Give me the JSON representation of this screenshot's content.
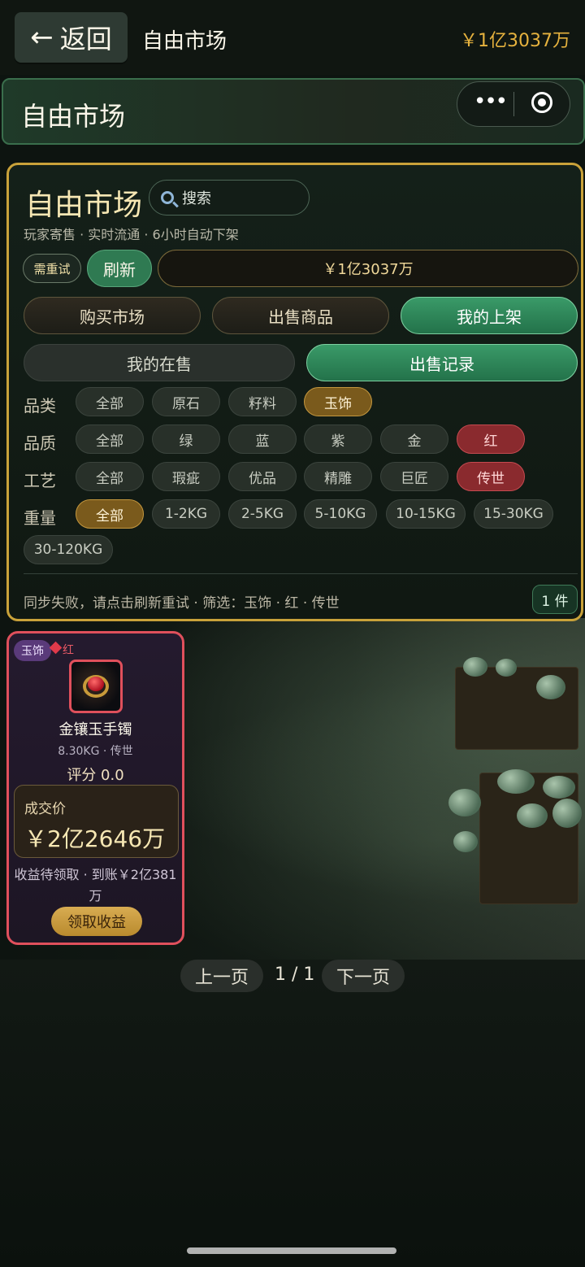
{
  "topbar": {
    "back_label": "返回",
    "title": "自由市场",
    "balance": "￥1亿3037万"
  },
  "navbar": {
    "title": "自由市场",
    "more_icon": "more-dots-icon",
    "close_icon": "target-icon"
  },
  "panel": {
    "title": "自由市场",
    "search_placeholder": "搜索",
    "subtitle": "玩家寄售 · 实时流通 · 6小时自动下架",
    "retry_badge": "需重试",
    "refresh_label": "刷新",
    "balance": "￥1亿3037万",
    "tabs_row1": [
      {
        "label": "购买市场",
        "active": false
      },
      {
        "label": "出售商品",
        "active": false
      },
      {
        "label": "我的上架",
        "active": true
      }
    ],
    "tabs_row2": [
      {
        "label": "我的在售",
        "active": false
      },
      {
        "label": "出售记录",
        "active": true
      }
    ],
    "filters": {
      "category": {
        "label": "品类",
        "options": [
          "全部",
          "原石",
          "籽料",
          "玉饰"
        ],
        "selected": "玉饰"
      },
      "quality": {
        "label": "品质",
        "options": [
          "全部",
          "绿",
          "蓝",
          "紫",
          "金",
          "红"
        ],
        "selected": "红"
      },
      "craft": {
        "label": "工艺",
        "options": [
          "全部",
          "瑕疵",
          "优品",
          "精雕",
          "巨匠",
          "传世"
        ],
        "selected": "传世"
      },
      "weight": {
        "label": "重量",
        "options": [
          "全部",
          "1-2KG",
          "2-5KG",
          "5-10KG",
          "10-15KG",
          "15-30KG",
          "30-120KG"
        ],
        "selected": "全部"
      }
    },
    "footer_text": "同步失败，请点击刷新重试 · 筛选：玉饰 · 红 · 传世",
    "count": "1 件"
  },
  "listing": {
    "category": "玉饰",
    "quality": "红",
    "name": "金镶玉手镯",
    "meta": "8.30KG · 传世",
    "score": "评分 0.0",
    "price_label": "成交价",
    "price_value": "￥2亿2646万",
    "settle_text": "收益待领取 · 到账￥2亿381万",
    "claim_label": "领取收益"
  },
  "pager": {
    "prev_label": "上一页",
    "info": "1 / 1",
    "next_label": "下一页"
  },
  "colors": {
    "accent_green": "#2f7a52",
    "accent_gold": "#c9a23a",
    "quality_red": "#e0505c",
    "balance_gold": "#e6b23e"
  }
}
